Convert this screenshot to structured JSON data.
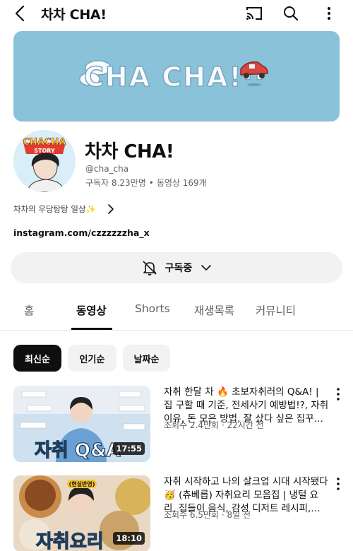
{
  "header": {
    "title": "차차 CHA!"
  },
  "channel": {
    "name": "차차 CHA!",
    "handle": "@cha_cha",
    "subscribers": "구독자 8.23만명",
    "separator": "•",
    "videos": "동영상 169개",
    "description": "차차의 우당탕탕 일상✨",
    "link": "instagram.com/czzzzzzha_x",
    "avatar_text_top": "CHACHA",
    "avatar_text_bottom": "STORY"
  },
  "banner": {
    "text": "CHA CHA!··"
  },
  "subscribe": {
    "label": "구독중"
  },
  "tabs": [
    {
      "label": "홈"
    },
    {
      "label": "동영상"
    },
    {
      "label": "Shorts"
    },
    {
      "label": "재생목록"
    },
    {
      "label": "커뮤니티"
    }
  ],
  "chips": [
    {
      "label": "최신순"
    },
    {
      "label": "인기순"
    },
    {
      "label": "날짜순"
    }
  ],
  "videos": [
    {
      "title": "자취 한달 차 🔥 초보자취러의 Q&A! | 집 구할 때 기준, 전세사기 예방법!?, 자취 이유, 돈 모은 방법, 잘 샀다 싶은 집꾸…",
      "meta": "조회수 2.4만회 · 22시간 전",
      "duration": "17:55",
      "thumb_caption": "자취 Q&A"
    },
    {
      "title": "자취 시작하고 나의 살크업 시대 시작됐다🥳 (츄베릅) 자취요리 모음집 | 냉털 요리, 집들이 음식, 감성 디저트 레시피,…",
      "meta": "조회수 6.5만회 · 8일 전",
      "duration": "18:10",
      "thumb_caption": "자취요리",
      "thumb_badge": "(현실반영)"
    }
  ],
  "colors": {
    "banner": "#89c2d9",
    "accent": "#0f0f0f",
    "chip_bg": "#f2f2f2"
  }
}
